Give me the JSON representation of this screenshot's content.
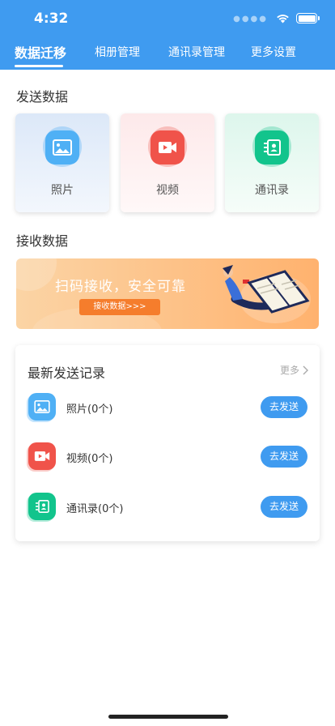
{
  "status_bar": {
    "time": "4:32"
  },
  "tabs": [
    {
      "label": "数据迁移",
      "active": true
    },
    {
      "label": "相册管理",
      "active": false
    },
    {
      "label": "通讯录管理",
      "active": false
    },
    {
      "label": "更多设置",
      "active": false
    }
  ],
  "send_section": {
    "title": "发送数据",
    "cards": [
      {
        "label": "照片",
        "icon": "photo-icon"
      },
      {
        "label": "视频",
        "icon": "video-icon"
      },
      {
        "label": "通讯录",
        "icon": "contacts-icon"
      }
    ]
  },
  "receive_section": {
    "title": "接收数据",
    "banner_text": "扫码接收，安全可靠",
    "banner_button": "接收数据>>>"
  },
  "records": {
    "title": "最新发送记录",
    "more_label": "更多",
    "items": [
      {
        "label": "照片(0个)",
        "button": "去发送",
        "icon": "photo-icon"
      },
      {
        "label": "视频(0个)",
        "button": "去发送",
        "icon": "video-icon"
      },
      {
        "label": "通讯录(0个)",
        "button": "去发送",
        "icon": "contacts-icon"
      }
    ]
  },
  "colors": {
    "primary": "#3f9bf0",
    "photo": "#4fb0f5",
    "video": "#f0534a",
    "contacts": "#12c48c",
    "banner_button": "#f57d2c"
  }
}
